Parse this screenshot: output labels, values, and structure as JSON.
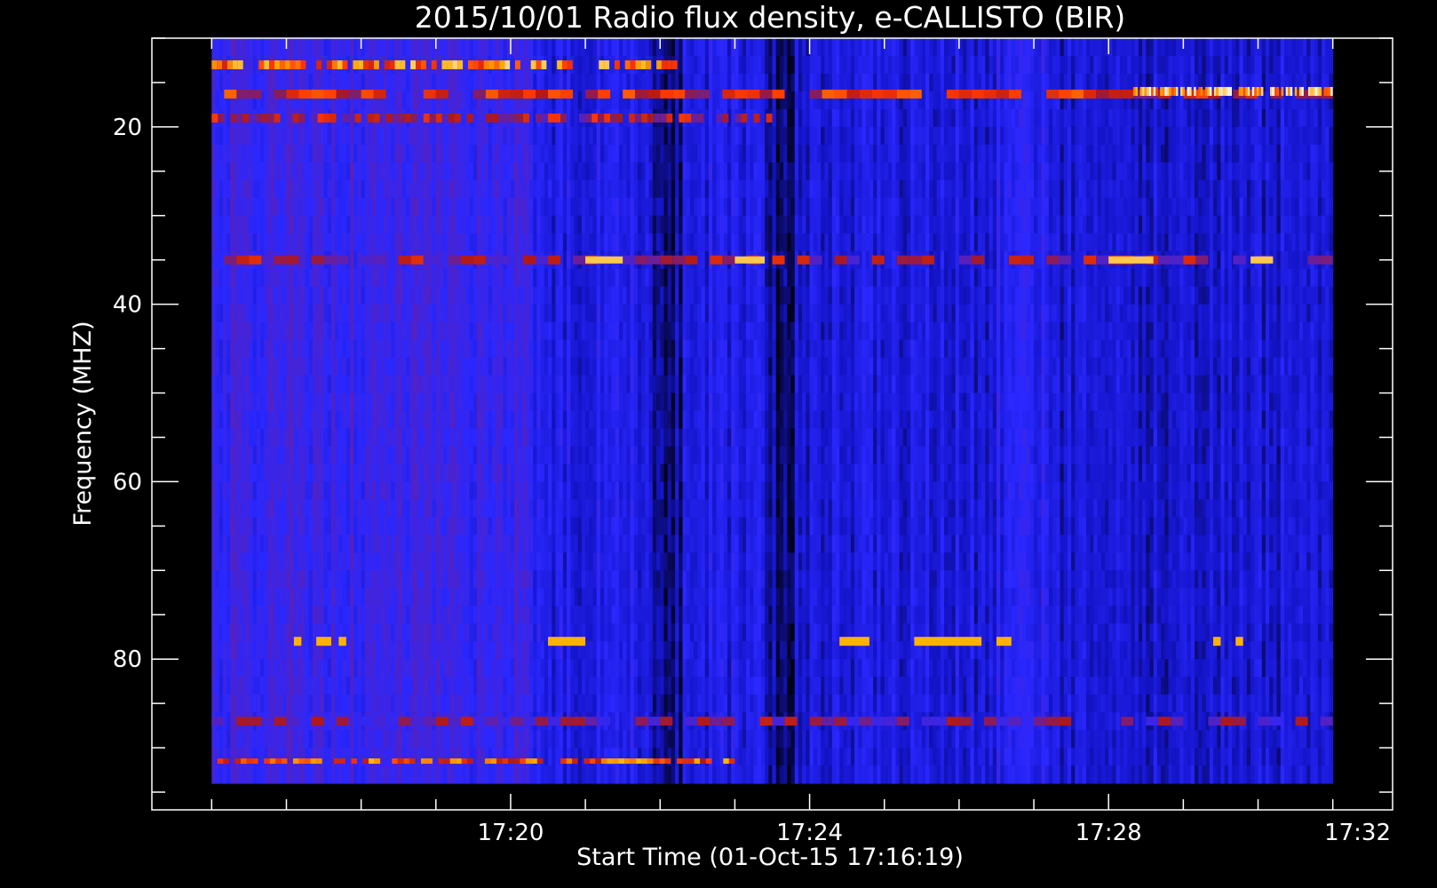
{
  "chart_data": {
    "type": "heatmap",
    "title": "2015/10/01  Radio flux density, e-CALLISTO (BIR)",
    "xlabel": "Start Time (01-Oct-15 17:16:19)",
    "ylabel": "Frequency (MHZ)",
    "x_unit": "minutes of day",
    "xlim": [
      1035.2,
      1051.8
    ],
    "data_xrange": [
      1036.0,
      1051.0
    ],
    "ylim": [
      10,
      97
    ],
    "data_yrange": [
      10,
      94
    ],
    "y_inverted": true,
    "x_ticks": [
      {
        "value": 1040,
        "label": "17:20"
      },
      {
        "value": 1044,
        "label": "17:24"
      },
      {
        "value": 1048,
        "label": "17:28"
      },
      {
        "value": 1052,
        "label": "17:32"
      }
    ],
    "y_ticks": [
      {
        "value": 20,
        "label": "20"
      },
      {
        "value": 40,
        "label": "40"
      },
      {
        "value": 60,
        "label": "60"
      },
      {
        "value": 80,
        "label": "80"
      }
    ],
    "colormap": [
      "#000000",
      "#1414c8",
      "#2a28ff",
      "#5a20b8",
      "#b01818",
      "#ff3a00",
      "#ffb000",
      "#ffffff"
    ],
    "background_level": 0.32,
    "darker_segments": [
      {
        "x": [
          1040.3,
          1041.9
        ],
        "level": 0.22
      },
      {
        "x": [
          1041.9,
          1042.3
        ],
        "level": 0.12
      },
      {
        "x": [
          1042.3,
          1043.4
        ],
        "level": 0.22
      },
      {
        "x": [
          1043.4,
          1043.8
        ],
        "level": 0.1
      },
      {
        "x": [
          1043.8,
          1046.5
        ],
        "level": 0.2
      },
      {
        "x": [
          1046.5,
          1047.3
        ],
        "level": 0.24
      },
      {
        "x": [
          1047.3,
          1051.0
        ],
        "level": 0.18
      }
    ],
    "bright_features": [
      {
        "kind": "band",
        "x": [
          1036.0,
          1042.3
        ],
        "y": [
          12.5,
          13.5
        ],
        "level": 0.78
      },
      {
        "kind": "band",
        "x": [
          1036.0,
          1051.0
        ],
        "y": [
          15.8,
          16.8
        ],
        "level": 0.62
      },
      {
        "kind": "band",
        "x": [
          1048.3,
          1051.0
        ],
        "y": [
          15.5,
          16.5
        ],
        "level": 0.88
      },
      {
        "kind": "band",
        "x": [
          1036.0,
          1043.5
        ],
        "y": [
          18.5,
          19.5
        ],
        "level": 0.56
      },
      {
        "kind": "band",
        "x": [
          1036.0,
          1051.0
        ],
        "y": [
          34.5,
          35.5
        ],
        "level": 0.52
      },
      {
        "kind": "band",
        "x": [
          1036.0,
          1043.0
        ],
        "y": [
          91.2,
          91.8
        ],
        "level": 0.72
      },
      {
        "kind": "band",
        "x": [
          1036.0,
          1051.0
        ],
        "y": [
          86.5,
          87.5
        ],
        "level": 0.46
      },
      {
        "kind": "blip",
        "x": [
          1037.1,
          1037.2
        ],
        "y": [
          77.5,
          78.5
        ],
        "level": 0.86
      },
      {
        "kind": "blip",
        "x": [
          1037.4,
          1037.6
        ],
        "y": [
          77.5,
          78.5
        ],
        "level": 0.86
      },
      {
        "kind": "blip",
        "x": [
          1037.7,
          1037.8
        ],
        "y": [
          77.5,
          78.5
        ],
        "level": 0.86
      },
      {
        "kind": "blip",
        "x": [
          1040.5,
          1041.0
        ],
        "y": [
          77.5,
          78.5
        ],
        "level": 0.86
      },
      {
        "kind": "blip",
        "x": [
          1044.4,
          1044.8
        ],
        "y": [
          77.5,
          78.5
        ],
        "level": 0.86
      },
      {
        "kind": "blip",
        "x": [
          1045.4,
          1046.3
        ],
        "y": [
          77.5,
          78.5
        ],
        "level": 0.86
      },
      {
        "kind": "blip",
        "x": [
          1046.5,
          1046.7
        ],
        "y": [
          77.5,
          78.5
        ],
        "level": 0.86
      },
      {
        "kind": "blip",
        "x": [
          1049.4,
          1049.5
        ],
        "y": [
          77.5,
          78.5
        ],
        "level": 0.86
      },
      {
        "kind": "blip",
        "x": [
          1049.7,
          1049.8
        ],
        "y": [
          77.5,
          78.5
        ],
        "level": 0.86
      },
      {
        "kind": "blip",
        "x": [
          1041.0,
          1041.5
        ],
        "y": [
          34.6,
          35.4
        ],
        "level": 0.9
      },
      {
        "kind": "blip",
        "x": [
          1043.0,
          1043.4
        ],
        "y": [
          34.6,
          35.4
        ],
        "level": 0.9
      },
      {
        "kind": "blip",
        "x": [
          1048.0,
          1048.6
        ],
        "y": [
          34.6,
          35.4
        ],
        "level": 0.9
      },
      {
        "kind": "blip",
        "x": [
          1049.9,
          1050.2
        ],
        "y": [
          34.6,
          35.4
        ],
        "level": 0.9
      }
    ]
  }
}
